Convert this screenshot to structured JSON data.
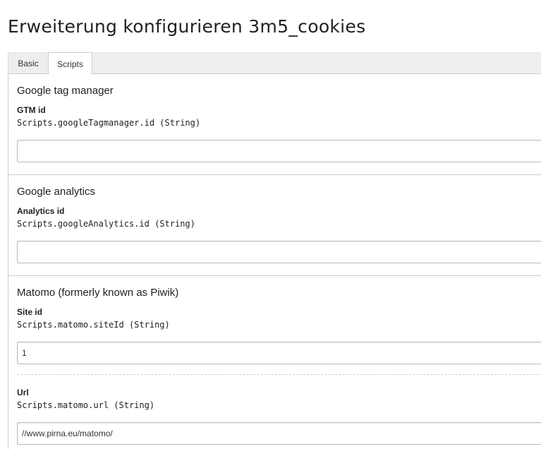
{
  "page": {
    "title": "Erweiterung konfigurieren 3m5_cookies"
  },
  "tabs": [
    {
      "label": "Basic",
      "active": false
    },
    {
      "label": "Scripts",
      "active": true
    }
  ],
  "sections": {
    "gtm": {
      "title": "Google tag manager",
      "fields": [
        {
          "label": "GTM id",
          "path": "Scripts.googleTagmanager.id (String)",
          "value": ""
        }
      ]
    },
    "ga": {
      "title": "Google analytics",
      "fields": [
        {
          "label": "Analytics id",
          "path": "Scripts.googleAnalytics.id (String)",
          "value": ""
        }
      ]
    },
    "matomo": {
      "title": "Matomo (formerly known as Piwik)",
      "fields": [
        {
          "label": "Site id",
          "path": "Scripts.matomo.siteId (String)",
          "value": "1"
        },
        {
          "label": "Url",
          "path": "Scripts.matomo.url (String)",
          "value": "//www.pirna.eu/matomo/"
        }
      ]
    }
  },
  "colors": {
    "tab_bar_bg": "#eeeeee",
    "border": "#cccccc",
    "text": "#212121"
  }
}
